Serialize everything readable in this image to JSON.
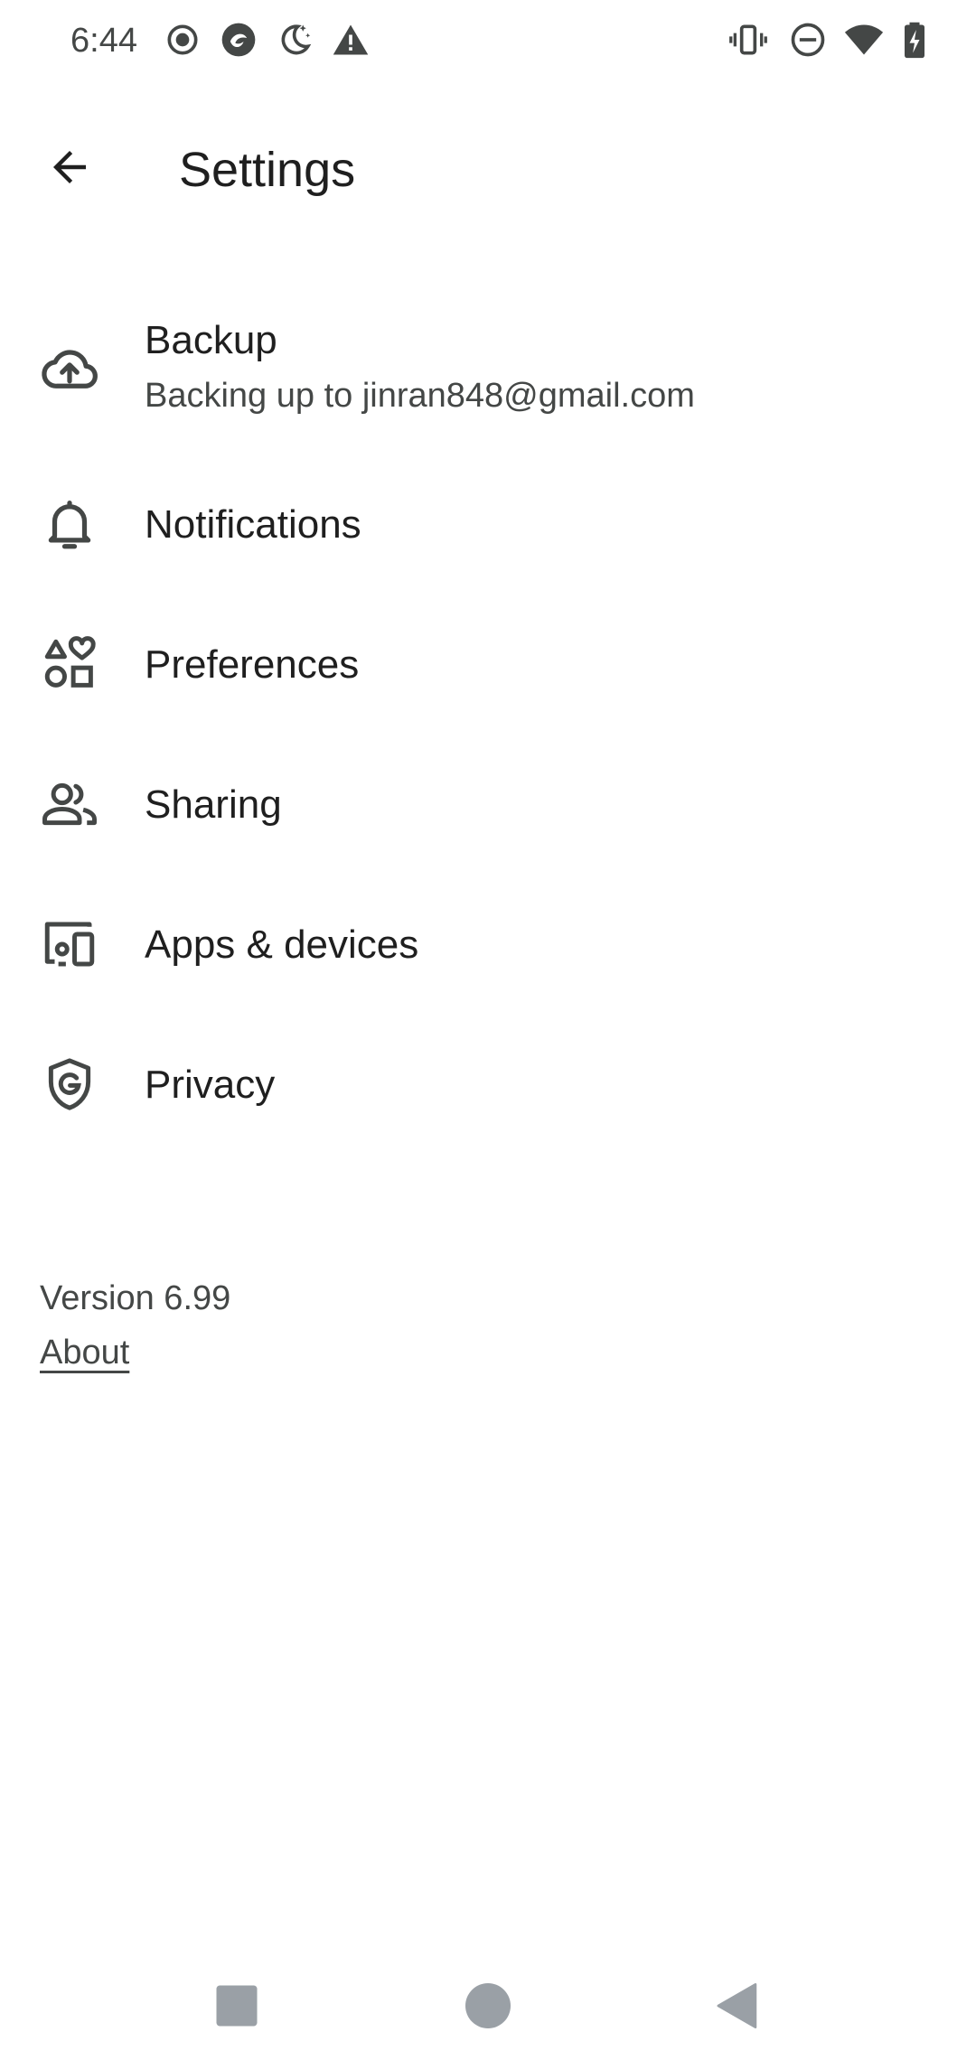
{
  "status_bar": {
    "time": "6:44",
    "left_icons": [
      "record-icon",
      "app-badge-icon",
      "night-mode-icon",
      "alert-icon"
    ],
    "right_icons": [
      "vibrate-icon",
      "do-not-disturb-icon",
      "wifi-icon",
      "battery-charging-icon"
    ]
  },
  "header": {
    "title": "Settings",
    "back_icon": "arrow-back-icon"
  },
  "settings": {
    "items": [
      {
        "title": "Backup",
        "subtitle": "Backing up to jinran848@gmail.com",
        "icon": "cloud-upload-icon"
      },
      {
        "title": "Notifications",
        "icon": "bell-icon"
      },
      {
        "title": "Preferences",
        "icon": "shapes-icon"
      },
      {
        "title": "Sharing",
        "icon": "people-icon"
      },
      {
        "title": "Apps & devices",
        "icon": "devices-icon"
      },
      {
        "title": "Privacy",
        "icon": "shield-g-icon"
      }
    ]
  },
  "footer": {
    "version": "Version 6.99",
    "about_label": "About"
  },
  "nav_bar": {
    "buttons": [
      "recents-square-icon",
      "home-circle-icon",
      "back-triangle-icon"
    ]
  },
  "colors": {
    "background": "#ffffff",
    "text_primary": "#1f1f1f",
    "text_secondary": "#444746",
    "icon": "#444746"
  }
}
